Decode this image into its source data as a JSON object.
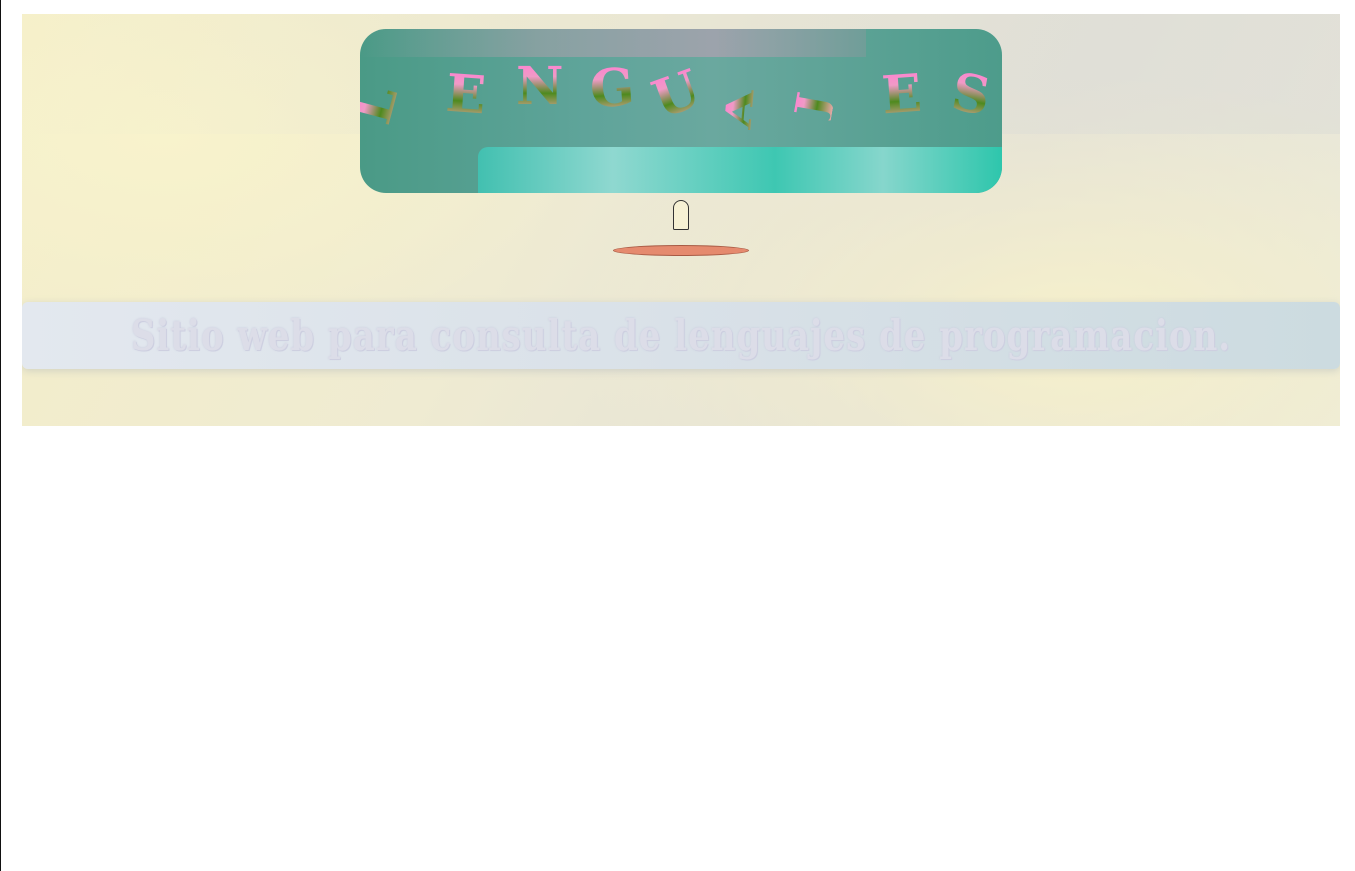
{
  "hero": {
    "title_letters": [
      "L",
      "E",
      "N",
      "G",
      "U",
      "A",
      "J",
      "E",
      "S"
    ],
    "subtitle": "Sitio web para consulta de lenguajes de programacion."
  },
  "colors": {
    "screen": "#4a9a86",
    "panel": "#3ec7b2",
    "accent_bar": "#e58a6e",
    "background": "#f4eec9"
  }
}
